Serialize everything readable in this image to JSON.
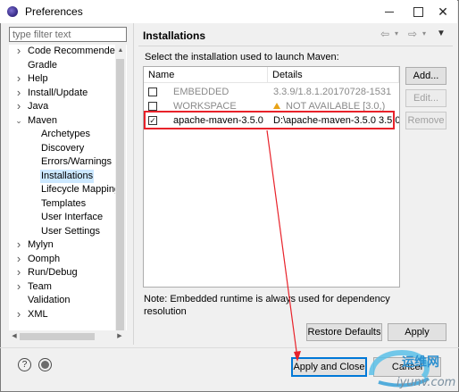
{
  "window": {
    "title": "Preferences"
  },
  "sidebar": {
    "filter_placeholder": "type filter text",
    "items": [
      {
        "label": "Code Recommenders",
        "level": 0,
        "expander": "collapsed"
      },
      {
        "label": "Gradle",
        "level": 0,
        "expander": "none"
      },
      {
        "label": "Help",
        "level": 0,
        "expander": "collapsed"
      },
      {
        "label": "Install/Update",
        "level": 0,
        "expander": "collapsed"
      },
      {
        "label": "Java",
        "level": 0,
        "expander": "collapsed"
      },
      {
        "label": "Maven",
        "level": 0,
        "expander": "expanded"
      },
      {
        "label": "Archetypes",
        "level": 1,
        "expander": "none"
      },
      {
        "label": "Discovery",
        "level": 1,
        "expander": "none"
      },
      {
        "label": "Errors/Warnings",
        "level": 1,
        "expander": "none"
      },
      {
        "label": "Installations",
        "level": 1,
        "expander": "none",
        "selected": true
      },
      {
        "label": "Lifecycle Mapping",
        "level": 1,
        "expander": "none"
      },
      {
        "label": "Templates",
        "level": 1,
        "expander": "none"
      },
      {
        "label": "User Interface",
        "level": 1,
        "expander": "none"
      },
      {
        "label": "User Settings",
        "level": 1,
        "expander": "none"
      },
      {
        "label": "Mylyn",
        "level": 0,
        "expander": "collapsed"
      },
      {
        "label": "Oomph",
        "level": 0,
        "expander": "collapsed"
      },
      {
        "label": "Run/Debug",
        "level": 0,
        "expander": "collapsed"
      },
      {
        "label": "Team",
        "level": 0,
        "expander": "collapsed"
      },
      {
        "label": "Validation",
        "level": 0,
        "expander": "none"
      },
      {
        "label": "XML",
        "level": 0,
        "expander": "collapsed"
      }
    ]
  },
  "main": {
    "title": "Installations",
    "description": "Select the installation used to launch Maven:",
    "table": {
      "columns": [
        "Name",
        "Details"
      ],
      "rows": [
        {
          "name": "EMBEDDED",
          "details": "3.3.9/1.8.1.20170728-1531",
          "checked": false,
          "dimmed": true,
          "warning": false
        },
        {
          "name": "WORKSPACE",
          "details": "NOT AVAILABLE [3.0,)",
          "checked": false,
          "dimmed": true,
          "warning": true
        },
        {
          "name": "apache-maven-3.5.0",
          "details": "D:\\apache-maven-3.5.0 3.5.0",
          "checked": true,
          "dimmed": false,
          "warning": false
        }
      ]
    },
    "buttons": {
      "add": "Add...",
      "edit": "Edit...",
      "remove": "Remove"
    },
    "note": "Note: Embedded runtime is always used for dependency resolution",
    "restore_defaults": "Restore Defaults",
    "apply": "Apply"
  },
  "footer": {
    "apply_and_close": "Apply and Close",
    "cancel": "Cancel"
  },
  "watermark": {
    "line1": "运维网",
    "line2": "iyunv.com"
  },
  "colors": {
    "highlight_red": "#e8222a",
    "selection": "#cce8ff",
    "focus_blue": "#0078d7"
  }
}
